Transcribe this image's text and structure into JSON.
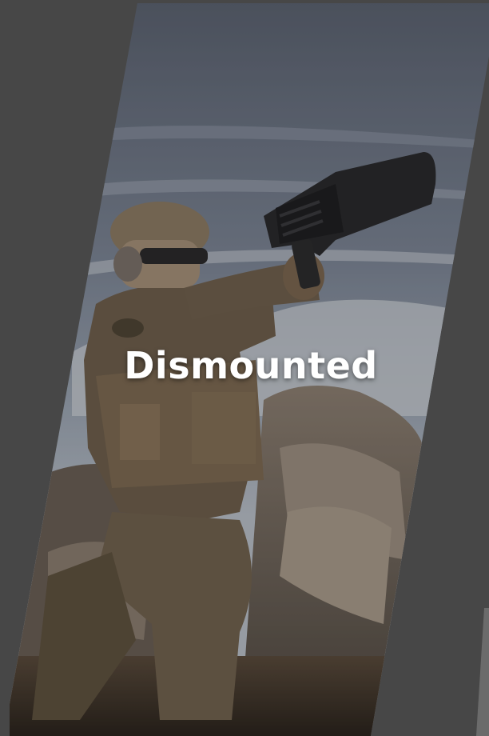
{
  "card": {
    "label": "Dismounted",
    "image_alt": "soldier-aiming-handheld-counter-drone-device"
  },
  "colors": {
    "background": "#474747",
    "label_text": "#ffffff"
  }
}
